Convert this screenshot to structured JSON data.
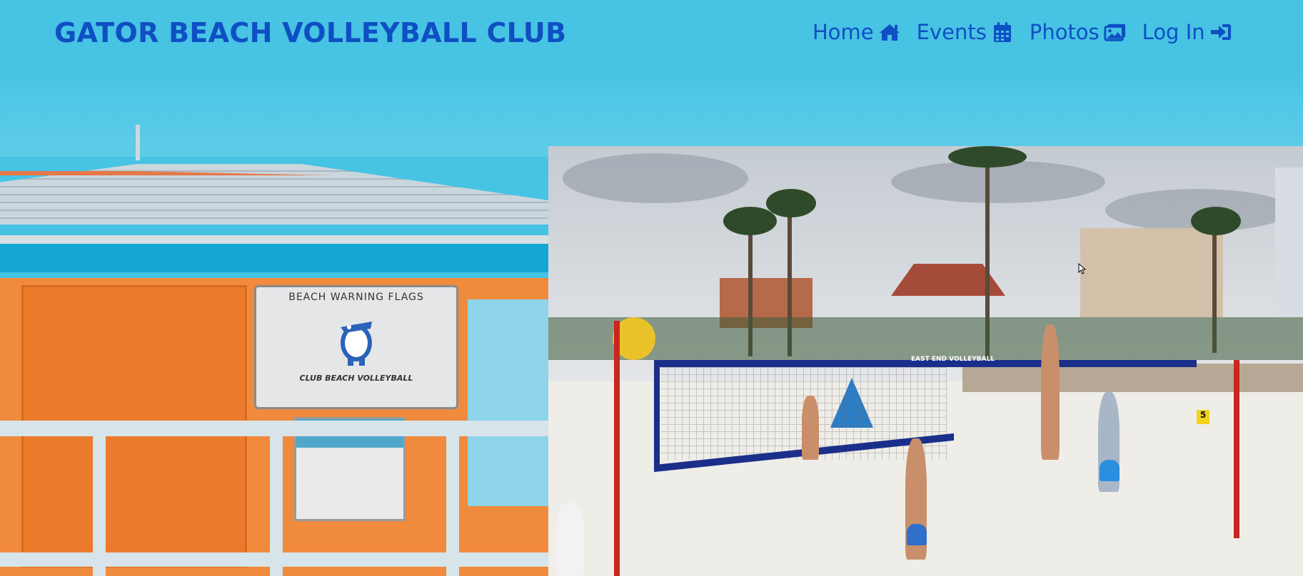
{
  "brand": {
    "title": "GATOR BEACH VOLLEYBALL CLUB"
  },
  "nav": {
    "items": [
      {
        "label": "Home",
        "icon": "home-icon"
      },
      {
        "label": "Events",
        "icon": "calendar-icon"
      },
      {
        "label": "Photos",
        "icon": "images-icon"
      },
      {
        "label": "Log In",
        "icon": "sign-in-icon"
      }
    ]
  },
  "hero": {
    "sign_title": "BEACH WARNING FLAGS",
    "sign_subtitle": "CLUB BEACH VOLLEYBALL",
    "net_banner": "EAST END VOLLEYBALL",
    "court_number": "5"
  },
  "colors": {
    "header_bg": "#47c3e3",
    "brand": "#0f4fc4",
    "tower_orange": "#f08a3c",
    "net_blue": "#1a2f8a"
  }
}
